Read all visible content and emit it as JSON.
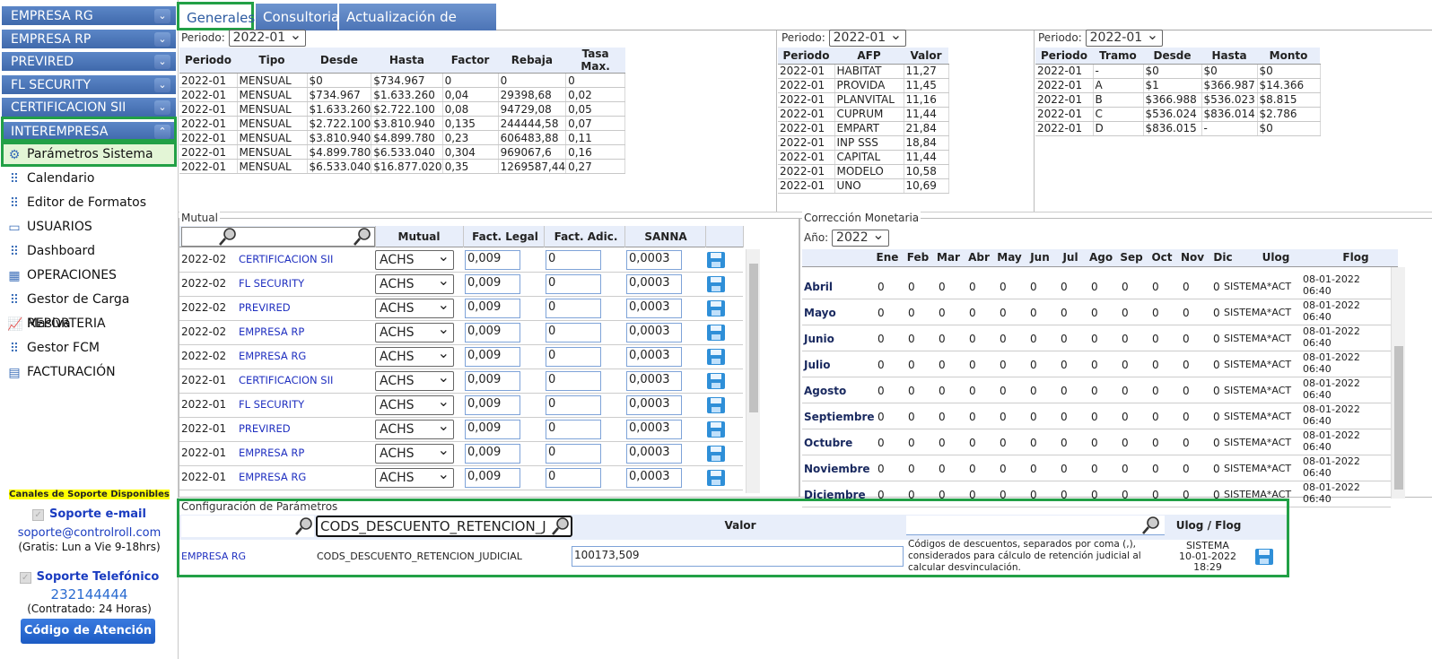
{
  "sidebar": {
    "accordions": [
      "EMPRESA RG",
      "EMPRESA RP",
      "PREVIRED",
      "FL SECURITY",
      "CERTIFICACION SII",
      "INTEREMPRESA"
    ],
    "items": [
      "Parámetros Sistema",
      "Calendario",
      "Editor de Formatos",
      "USUARIOS",
      "Dashboard",
      "OPERACIONES",
      "Gestor de Carga Masiva",
      "REPORTERIA",
      "Gestor FCM",
      "FACTURACIÓN"
    ],
    "icons": [
      "gears-icon",
      "tree-icon",
      "tree-icon",
      "window-icon",
      "tree-icon",
      "grid-icon",
      "tree-icon",
      "chart-icon",
      "tree-icon",
      "invoice-icon"
    ]
  },
  "support": {
    "channels": "Canales de Soporte Disponibles",
    "email_title": "Soporte e-mail",
    "email": "soporte@controlroll.com",
    "email_hours": "(Gratis: Lun a Vie 9-18hrs)",
    "phone_title": "Soporte Telefónico",
    "phone": "232144444",
    "phone_hours": "(Contratado: 24 Horas)",
    "code_button": "Código de Atención"
  },
  "tabs": [
    "Generales",
    "Consultoria",
    "Actualización de versión"
  ],
  "impuesto": {
    "periodo_label": "Periodo:",
    "periodo": "2022-01",
    "headers": [
      "Periodo",
      "Tipo",
      "Desde",
      "Hasta",
      "Factor",
      "Rebaja",
      "Tasa Max."
    ],
    "rows": [
      [
        "2022-01",
        "MENSUAL",
        "$0",
        "$734.967",
        "0",
        "0",
        "0"
      ],
      [
        "2022-01",
        "MENSUAL",
        "$734.967",
        "$1.633.260",
        "0,04",
        "29398,68",
        "0,02"
      ],
      [
        "2022-01",
        "MENSUAL",
        "$1.633.260",
        "$2.722.100",
        "0,08",
        "94729,08",
        "0,05"
      ],
      [
        "2022-01",
        "MENSUAL",
        "$2.722.100",
        "$3.810.940",
        "0,135",
        "244444,58",
        "0,07"
      ],
      [
        "2022-01",
        "MENSUAL",
        "$3.810.940",
        "$4.899.780",
        "0,23",
        "606483,88",
        "0,11"
      ],
      [
        "2022-01",
        "MENSUAL",
        "$4.899.780",
        "$6.533.040",
        "0,304",
        "969067,6",
        "0,16"
      ],
      [
        "2022-01",
        "MENSUAL",
        "$6.533.040",
        "$16.877.020",
        "0,35",
        "1269587,44",
        "0,27"
      ]
    ]
  },
  "afp": {
    "periodo_label": "Periodo:",
    "periodo": "2022-01",
    "headers": [
      "Periodo",
      "AFP",
      "Valor"
    ],
    "rows": [
      [
        "2022-01",
        "HABITAT",
        "11,27"
      ],
      [
        "2022-01",
        "PROVIDA",
        "11,45"
      ],
      [
        "2022-01",
        "PLANVITAL",
        "11,16"
      ],
      [
        "2022-01",
        "CUPRUM",
        "11,44"
      ],
      [
        "2022-01",
        "EMPART",
        "21,84"
      ],
      [
        "2022-01",
        "INP SSS",
        "18,84"
      ],
      [
        "2022-01",
        "CAPITAL",
        "11,44"
      ],
      [
        "2022-01",
        "MODELO",
        "10,58"
      ],
      [
        "2022-01",
        "UNO",
        "10,69"
      ]
    ]
  },
  "tramos": {
    "periodo_label": "Periodo:",
    "periodo": "2022-01",
    "headers": [
      "Periodo",
      "Tramo",
      "Desde",
      "Hasta",
      "Monto"
    ],
    "rows": [
      [
        "2022-01",
        "-",
        "$0",
        "$0",
        "$0"
      ],
      [
        "2022-01",
        "A",
        "$1",
        "$366.987",
        "$14.366"
      ],
      [
        "2022-01",
        "B",
        "$366.988",
        "$536.023",
        "$8.815"
      ],
      [
        "2022-01",
        "C",
        "$536.024",
        "$836.014",
        "$2.786"
      ],
      [
        "2022-01",
        "D",
        "$836.015",
        "-",
        "$0"
      ]
    ]
  },
  "mutual": {
    "legend": "Mutual",
    "headers": [
      "Mutual",
      "Fact. Legal",
      "Fact. Adic.",
      "SANNA"
    ],
    "rows": [
      [
        "2022-02",
        "CERTIFICACION SII",
        "ACHS",
        "0,009",
        "0",
        "0,0003"
      ],
      [
        "2022-02",
        "FL SECURITY",
        "ACHS",
        "0,009",
        "0",
        "0,0003"
      ],
      [
        "2022-02",
        "PREVIRED",
        "ACHS",
        "0,009",
        "0",
        "0,0003"
      ],
      [
        "2022-02",
        "EMPRESA RP",
        "ACHS",
        "0,009",
        "0",
        "0,0003"
      ],
      [
        "2022-02",
        "EMPRESA RG",
        "ACHS",
        "0,009",
        "0",
        "0,0003"
      ],
      [
        "2022-01",
        "CERTIFICACION SII",
        "ACHS",
        "0,009",
        "0",
        "0,0003"
      ],
      [
        "2022-01",
        "FL SECURITY",
        "ACHS",
        "0,009",
        "0",
        "0,0003"
      ],
      [
        "2022-01",
        "PREVIRED",
        "ACHS",
        "0,009",
        "0",
        "0,0003"
      ],
      [
        "2022-01",
        "EMPRESA RP",
        "ACHS",
        "0,009",
        "0",
        "0,0003"
      ],
      [
        "2022-01",
        "EMPRESA RG",
        "ACHS",
        "0,009",
        "0",
        "0,0003"
      ]
    ]
  },
  "correccion": {
    "legend": "Corrección Monetaria",
    "year_label": "Año:",
    "year": "2022",
    "headers": [
      "Ene",
      "Feb",
      "Mar",
      "Abr",
      "May",
      "Jun",
      "Jul",
      "Ago",
      "Sep",
      "Oct",
      "Nov",
      "Dic",
      "Ulog",
      "Flog"
    ],
    "months": [
      "Abril",
      "Mayo",
      "Junio",
      "Julio",
      "Agosto",
      "Septiembre",
      "Octubre",
      "Noviembre",
      "Diciembre"
    ],
    "value": "0",
    "ulog": "SISTEMA*ACT",
    "flog_date": "08-01-2022",
    "flog_time": "06:40"
  },
  "config": {
    "legend": "Configuración de Parámetros",
    "filter_value": "CODS_DESCUENTO_RETENCION_J",
    "headers": [
      "Valor",
      "Ulog / Flog"
    ],
    "row": {
      "empresa": "EMPRESA RG",
      "codigo": "CODS_DESCUENTO_RETENCION_JUDICIAL",
      "valor": "100173,509",
      "descripcion": "Códigos de descuentos, separados por coma (,), considerados para cálculo de retención judicial al calcular desvinculación.",
      "ulog": "SISTEMA",
      "fdate": "10-01-2022",
      "ftime": "18:29"
    }
  },
  "colors": {
    "accent_green": "#22a046",
    "header_blue": "#4c74b6",
    "link_blue": "#2030c0"
  }
}
